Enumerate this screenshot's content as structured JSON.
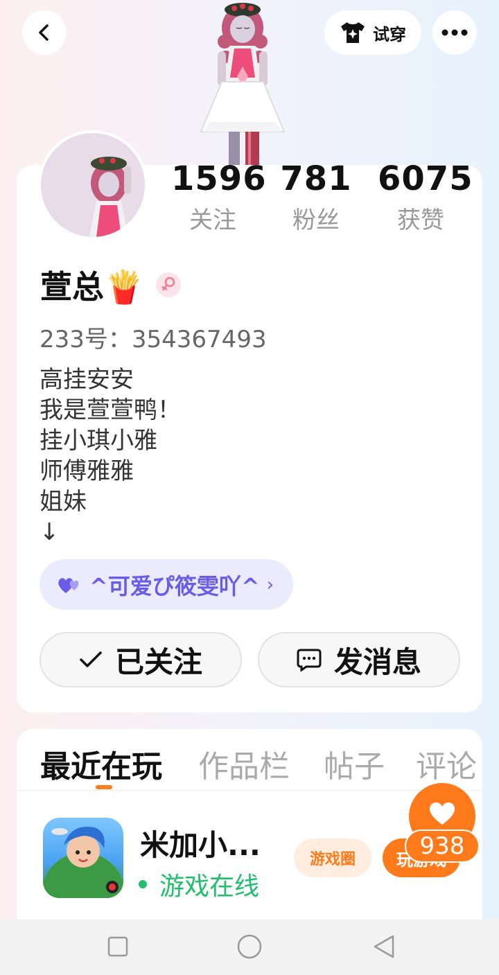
{
  "topbar": {
    "back_icon": "chevron-left-icon",
    "tryon_label": "试穿",
    "tryon_icon": "tshirt-sparkle-icon",
    "more_icon": "more-dots-icon"
  },
  "profile": {
    "stats": [
      {
        "value": "1596",
        "label": "关注"
      },
      {
        "value": "781",
        "label": "粉丝"
      },
      {
        "value": "6075",
        "label": "获赞"
      }
    ],
    "name": "萱总🍟",
    "gender_icon": "female-icon",
    "uid": "233号：354367493",
    "bio": "高挂安安\n我是萱萱鸭！\n挂小琪小雅\n师傅雅雅\n姐妹\n↓",
    "relation_pill": {
      "icon": "heart-pair-icon",
      "text": "^可爱ぴ筱雯吖^",
      "arrow": "›"
    },
    "follow_button": {
      "label": "已关注",
      "icon": "check-icon"
    },
    "message_button": {
      "label": "发消息",
      "icon": "chat-bubble-icon"
    }
  },
  "tabs": [
    {
      "label": "最近在玩",
      "active": true
    },
    {
      "label": "作品栏",
      "active": false
    },
    {
      "label": "帖子",
      "active": false
    },
    {
      "label": "评论",
      "active": false
    }
  ],
  "recent_game": {
    "name": "米加小...",
    "status": "游戏在线",
    "tag_circle": "游戏圈",
    "tag_play": "玩游戏"
  },
  "like_fab": {
    "icon": "heart-icon",
    "count": "938"
  },
  "colors": {
    "accent": "#ff7a1a",
    "online": "#1fbf6b",
    "pill_text": "#6b5ce7",
    "pill_bg": "#ecebfe"
  },
  "navbar": {
    "icons": [
      "square-recent-icon",
      "circle-home-icon",
      "triangle-back-icon"
    ]
  }
}
